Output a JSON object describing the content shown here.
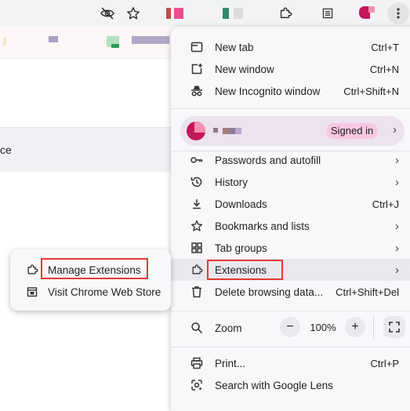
{
  "toolbar": {
    "icons": [
      "eye-off-icon",
      "star-icon",
      "extensions-puzzle-icon",
      "reading-list-icon",
      "profile-avatar",
      "more-vert-icon"
    ]
  },
  "page": {
    "partial_text": "ce"
  },
  "menu": {
    "items": [
      {
        "label": "New tab",
        "shortcut": "Ctrl+T",
        "icon": "new-tab-icon"
      },
      {
        "label": "New window",
        "shortcut": "Ctrl+N",
        "icon": "new-window-icon"
      },
      {
        "label": "New Incognito window",
        "shortcut": "Ctrl+Shift+N",
        "icon": "incognito-icon"
      }
    ],
    "profile": {
      "status": "Signed in"
    },
    "items2": [
      {
        "label": "Passwords and autofill",
        "icon": "key-icon"
      },
      {
        "label": "History",
        "icon": "history-icon"
      },
      {
        "label": "Downloads",
        "shortcut": "Ctrl+J",
        "icon": "download-icon"
      },
      {
        "label": "Bookmarks and lists",
        "icon": "star-icon"
      },
      {
        "label": "Tab groups",
        "icon": "tab-groups-icon"
      },
      {
        "label": "Extensions",
        "icon": "extensions-icon"
      },
      {
        "label": "Delete browsing data...",
        "shortcut": "Ctrl+Shift+Del",
        "icon": "trash-icon"
      }
    ],
    "zoom": {
      "label": "Zoom",
      "value": "100%",
      "minus": "−",
      "plus": "+"
    },
    "items3": [
      {
        "label": "Print...",
        "shortcut": "Ctrl+P",
        "icon": "print-icon"
      },
      {
        "label": "Search with Google Lens",
        "icon": "lens-icon"
      }
    ]
  },
  "submenu": {
    "items": [
      {
        "label": "Manage Extensions",
        "icon": "extensions-icon"
      },
      {
        "label": "Visit Chrome Web Store",
        "icon": "web-store-icon"
      }
    ]
  },
  "colors": {
    "highlight_box": "#e53935",
    "signed_in_badge": "#f7c7e3",
    "menu_bg": "#f8f8fa",
    "hover_row": "#e8e8ee"
  }
}
